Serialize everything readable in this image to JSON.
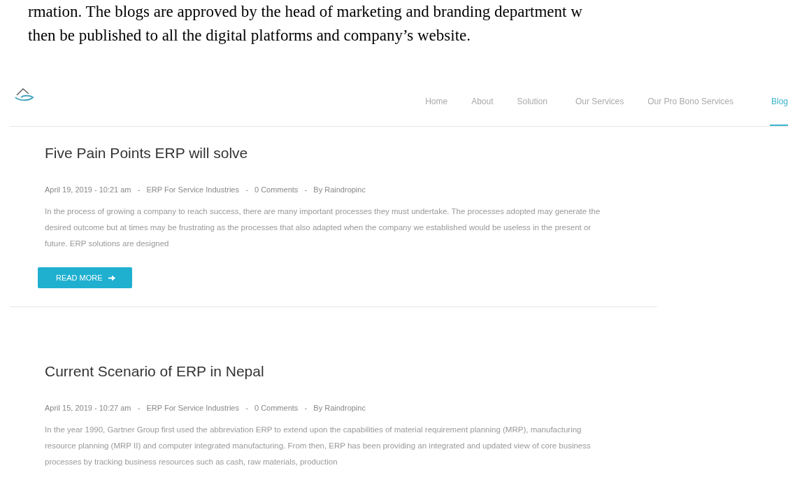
{
  "document_text": [
    "rmation. The blogs are approved by the head of marketing and branding department w",
    "then be published to all the digital platforms and company’s website."
  ],
  "nav": {
    "items": [
      {
        "label": "Home",
        "selected": false
      },
      {
        "label": "About",
        "selected": false
      },
      {
        "label": "Solution",
        "selected": false
      },
      {
        "label": "Our Services",
        "selected": false
      },
      {
        "label": "Our Pro Bono Services",
        "selected": false
      },
      {
        "label": "Blog",
        "selected": true
      }
    ]
  },
  "posts": [
    {
      "title": "Five Pain Points ERP will solve",
      "meta": "April 19, 2019 - 10:21 am   -   ERP For Service Industries   -   0 Comments   -   By Raindropinc",
      "excerpt": "In the process of growing a company to reach success, there are many important processes they must undertake. The processes adopted may generate the desired outcome but at times may be frustrating as the processes that also adapted when the company we established would be useless in the present or future. ERP solutions are designed",
      "button": "READ MORE"
    },
    {
      "title": "Current Scenario of ERP in Nepal",
      "meta": "April 15, 2019 - 10:27 am   -   ERP For Service Industries   -   0 Comments   -   By Raindropinc",
      "excerpt": "In the year 1990, Gartner Group first used the abbreviation ERP to extend upon the capabilities of material requirement planning (MRP), manufacturing resource planning (MRP II) and computer integrated manufacturing. From then, ERP has been providing an integrated and updated view of core business processes by tracking business resources such as cash, raw materials, production"
    }
  ]
}
